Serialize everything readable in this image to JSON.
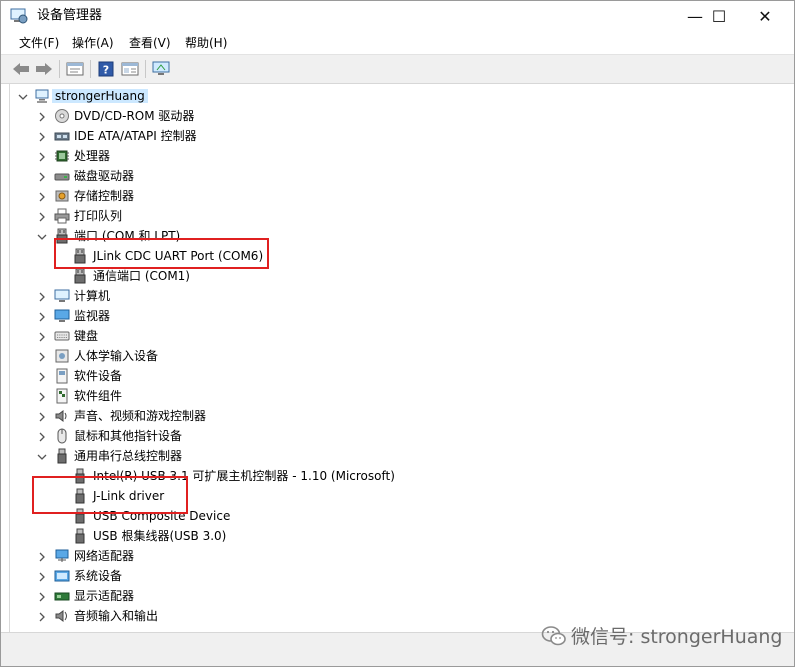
{
  "window": {
    "title": "设备管理器",
    "controls": {
      "minimize": "—",
      "maximize": "☐",
      "close": "✕"
    }
  },
  "menu": [
    "文件(F)",
    "操作(A)",
    "查看(V)",
    "帮助(H)"
  ],
  "toolbar": {
    "icons": [
      "back-icon",
      "forward-icon",
      "properties-icon",
      "help-icon",
      "view-icon",
      "monitor-icon"
    ]
  },
  "tree": {
    "root": "strongerHuang",
    "items": [
      {
        "label": "DVD/CD-ROM 驱动器",
        "icon": "dvd-icon",
        "expanded": false
      },
      {
        "label": "IDE ATA/ATAPI 控制器",
        "icon": "ide-icon",
        "expanded": false
      },
      {
        "label": "处理器",
        "icon": "processor-icon",
        "expanded": false
      },
      {
        "label": "磁盘驱动器",
        "icon": "disk-icon",
        "expanded": false
      },
      {
        "label": "存储控制器",
        "icon": "storage-icon",
        "expanded": false
      },
      {
        "label": "打印队列",
        "icon": "printer-icon",
        "expanded": false
      },
      {
        "label": "端口 (COM 和 LPT)",
        "icon": "port-icon",
        "expanded": true,
        "children": [
          "JLink CDC UART Port (COM6)",
          "通信端口 (COM1)"
        ]
      },
      {
        "label": "计算机",
        "icon": "computer-icon",
        "expanded": false
      },
      {
        "label": "监视器",
        "icon": "monitor-icon",
        "expanded": false
      },
      {
        "label": "键盘",
        "icon": "keyboard-icon",
        "expanded": false
      },
      {
        "label": "人体学输入设备",
        "icon": "hid-icon",
        "expanded": false
      },
      {
        "label": "软件设备",
        "icon": "software-device-icon",
        "expanded": false
      },
      {
        "label": "软件组件",
        "icon": "software-component-icon",
        "expanded": false
      },
      {
        "label": "声音、视频和游戏控制器",
        "icon": "sound-icon",
        "expanded": false
      },
      {
        "label": "鼠标和其他指针设备",
        "icon": "mouse-icon",
        "expanded": false
      },
      {
        "label": "通用串行总线控制器",
        "icon": "usb-icon",
        "expanded": true,
        "children": [
          "Intel(R) USB 3.1 可扩展主机控制器 - 1.10 (Microsoft)",
          "J-Link driver",
          "USB Composite Device",
          "USB 根集线器(USB 3.0)"
        ]
      },
      {
        "label": "网络适配器",
        "icon": "network-icon",
        "expanded": false
      },
      {
        "label": "系统设备",
        "icon": "system-icon",
        "expanded": false
      },
      {
        "label": "显示适配器",
        "icon": "display-icon",
        "expanded": false
      },
      {
        "label": "音频输入和输出",
        "icon": "audio-icon",
        "expanded": false
      }
    ]
  },
  "watermark": "微信号: strongerHuang",
  "colors": {
    "highlight": "#e02020",
    "selection": "#cce8ff"
  }
}
